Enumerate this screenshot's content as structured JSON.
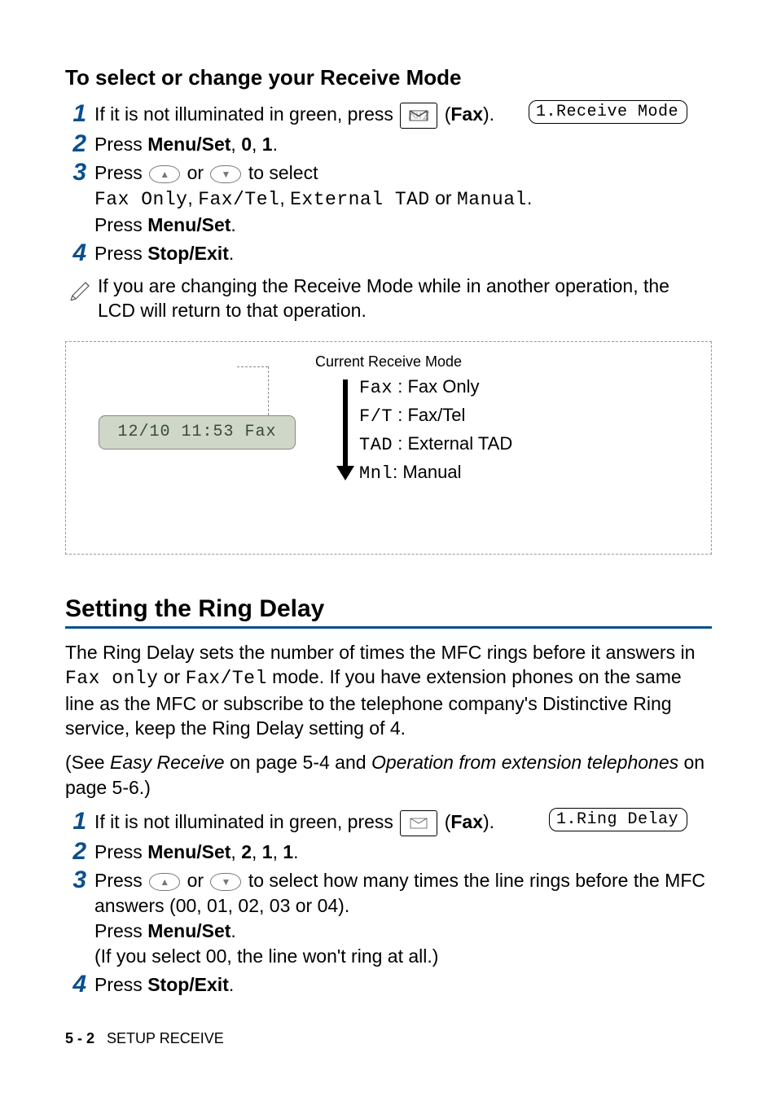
{
  "section1": {
    "title": "To select or change your Receive Mode",
    "steps": [
      {
        "text_before": "If it is not illuminated in green, press ",
        "fax_label": "Fax",
        "text_after": " (",
        "text_end": ")."
      },
      {
        "text": "Press ",
        "bold": "Menu/Set",
        "rest": ", ",
        "b2": "0",
        "rest2": ", ",
        "b3": "1",
        "rest3": "."
      },
      {
        "text": "Press ",
        "mid": " or ",
        "end": " to select",
        "line2_modes": [
          "Fax Only",
          "Fax/Tel",
          "External TAD",
          "Manual"
        ],
        "line2_sep": [
          ", ",
          ", ",
          " or ",
          "."
        ],
        "line3": "Press ",
        "line3_bold": "Menu/Set",
        "line3_end": "."
      },
      {
        "text": "Press ",
        "bold": "Stop/Exit",
        "rest": "."
      }
    ],
    "lcd_float": "1.Receive Mode",
    "note": "If you are changing the Receive Mode while in another operation, the LCD will return to that operation."
  },
  "diagram": {
    "current_label": "Current Receive Mode",
    "lcd_text": "12/10 11:53  Fax",
    "modes": [
      {
        "code": "Fax",
        "label": "Fax Only"
      },
      {
        "code": "F/T",
        "label": "Fax/Tel"
      },
      {
        "code": "TAD",
        "label": "External TAD"
      },
      {
        "code": "Mnl",
        "label": "Manual"
      }
    ]
  },
  "section2": {
    "title": "Setting the Ring Delay",
    "para1_a": "The Ring Delay sets the number of times the MFC rings before it answers in ",
    "para1_m1": "Fax only",
    "para1_b": " or ",
    "para1_m2": "Fax/Tel",
    "para1_c": " mode. If you have extension phones on the same line as the MFC or subscribe to the telephone company's Distinctive Ring service, keep the Ring Delay setting of 4.",
    "para2_a": "(See ",
    "para2_i1": "Easy Receive",
    "para2_b": " on page 5-4 and ",
    "para2_i2": "Operation from extension telephones",
    "para2_c": " on page 5-6.)",
    "lcd_float": "1.Ring Delay",
    "steps": [
      {
        "text_before": "If it is not illuminated in green, press ",
        "fax_label": "Fax",
        "text_after": " (",
        "text_end": ")."
      },
      {
        "text": "Press ",
        "bold": "Menu/Set",
        "rest": ", ",
        "b2": "2",
        "rest2": ", ",
        "b3": "1",
        "rest3": ", ",
        "b4": "1",
        "rest4": "."
      },
      {
        "text": "Press ",
        "mid": " or ",
        "end": " to select how many times the line rings before the MFC answers (00, 01, 02, 03 or 04).",
        "line3": "Press ",
        "line3_bold": "Menu/Set",
        "line3_end": ".",
        "line4": "(If you select 00, the line won't ring at all.)"
      },
      {
        "text": "Press ",
        "bold": "Stop/Exit",
        "rest": "."
      }
    ]
  },
  "footer": {
    "page": "5 - 2",
    "label": "SETUP RECEIVE"
  }
}
